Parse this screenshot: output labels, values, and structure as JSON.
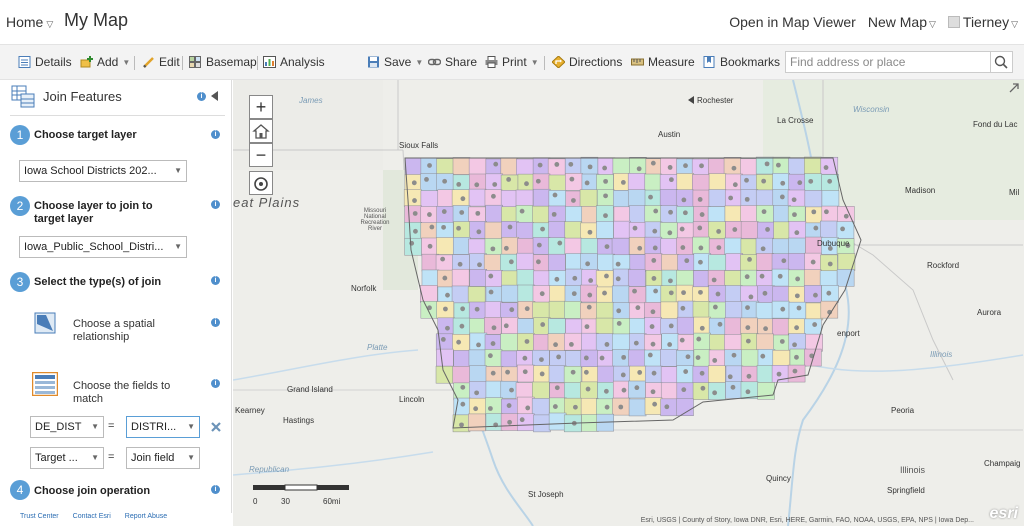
{
  "topbar": {
    "home_label": "Home",
    "map_title": "My Map",
    "open_viewer": "Open in Map Viewer",
    "new_map": "New Map",
    "user": "Tierney"
  },
  "toolbar": {
    "details": "Details",
    "add": "Add",
    "edit": "Edit",
    "basemap": "Basemap",
    "analysis": "Analysis",
    "save": "Save",
    "share": "Share",
    "print": "Print",
    "directions": "Directions",
    "measure": "Measure",
    "bookmarks": "Bookmarks",
    "search_placeholder": "Find address or place"
  },
  "panel": {
    "title": "Join Features",
    "step1": {
      "num": "1",
      "label": "Choose target layer",
      "value": "Iowa School Districts 202..."
    },
    "step2": {
      "num": "2",
      "label": "Choose layer to join to target layer",
      "value": "Iowa_Public_School_Distri..."
    },
    "step3": {
      "num": "3",
      "label": "Select the type(s) of join"
    },
    "option_spatial": "Choose a spatial relationship",
    "option_fields": "Choose the fields to match",
    "field_left_1": "DE_DIST",
    "field_right_1": "DISTRI...",
    "field_left_2": "Target ...",
    "field_right_2": "Join field",
    "equals": "=",
    "step4": {
      "num": "4",
      "label": "Choose join operation"
    },
    "info": "i"
  },
  "footer": {
    "trust": "Trust Center",
    "contact": "Contact Esri",
    "report": "Report Abuse"
  },
  "map": {
    "labels": {
      "rochester": "Rochester",
      "lacrosse": "La Crosse",
      "austin": "Austin",
      "fond": "Fond du Lac",
      "sioux": "Sioux Falls",
      "madison": "Madison",
      "mil": "Mil",
      "great_plains": "eat Plains",
      "missouri": "Missouri National Recreation River",
      "dubuque": "Dubuque",
      "rockford": "Rockford",
      "norfolk": "Norfolk",
      "aurora": "Aurora",
      "enport": "enport",
      "platte": "Platte",
      "illinois_river": "Illinois",
      "grand_island": "Grand Island",
      "lincoln": "Lincoln",
      "kearney": "Kearney",
      "hastings": "Hastings",
      "peoria": "Peoria",
      "republican": "Republican",
      "illinois": "Illinois",
      "champaign": "Champaig",
      "quincy": "Quincy",
      "springfield": "Springfield",
      "stjoseph": "St Joseph",
      "james": "James",
      "wisconsin": "Wisconsin"
    },
    "scale": [
      "0",
      "30",
      "60mi"
    ],
    "attribution": "Esri, USGS | County of Story, Iowa DNR, Esri, HERE, Garmin, FAO, NOAA, USGS, EPA, NPS | Iowa Dep...",
    "esri_logo": "esri"
  },
  "colors": {
    "accent": "#5a9ed6",
    "district_palette": [
      "#b9d7f2",
      "#cbb7ef",
      "#f3c8e4",
      "#c9efc3",
      "#f6e8b4",
      "#e2c3f4",
      "#b7e8e0",
      "#d8e7a8",
      "#f1d1bd",
      "#c4cdf4",
      "#e9b9d9",
      "#bfe3f7"
    ]
  }
}
